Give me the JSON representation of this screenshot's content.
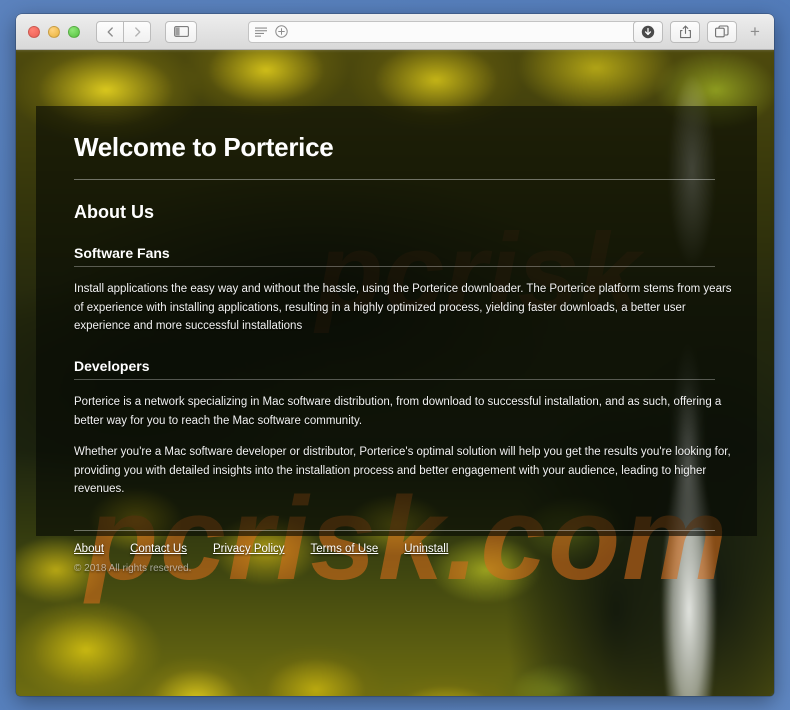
{
  "window": {
    "traffic_lights": [
      {
        "name": "close",
        "color": "#ec5f55"
      },
      {
        "name": "minimize",
        "color": "#e9b23c"
      },
      {
        "name": "zoom",
        "color": "#55c13f"
      }
    ]
  },
  "toolbar": {
    "back_icon": "chevron-left-icon",
    "forward_icon": "chevron-right-icon",
    "sidebar_icon": "sidebar-toggle-icon",
    "reader_icon": "reader-view-icon",
    "zoom_icon": "page-zoom-icon",
    "reload_icon": "reload-icon",
    "downloads_icon": "downloads-icon",
    "share_icon": "share-icon",
    "tabs_icon": "show-tabs-icon",
    "newtab_label": "+",
    "url_value": "",
    "url_placeholder": ""
  },
  "page": {
    "title": "Welcome to Porterice",
    "about_heading": "About Us",
    "sections": [
      {
        "heading": "Software Fans",
        "paragraphs": [
          "Install applications the easy way and without the hassle, using the Porterice downloader. The Porterice platform stems from years of experience with installing applications, resulting in a highly optimized process, yielding faster downloads, a better user experience and more successful installations"
        ]
      },
      {
        "heading": "Developers",
        "paragraphs": [
          "Porterice is a network specializing in Mac software distribution, from download to successful installation, and as such, offering a better way for you to reach the Mac software community.",
          "Whether you're a Mac software developer or distributor, Porterice's optimal solution will help you get the results you're looking for, providing you with detailed insights into the installation process and better engagement with your audience, leading to higher revenues."
        ]
      }
    ],
    "footer": {
      "links": [
        {
          "label": "About"
        },
        {
          "label": "Contact Us"
        },
        {
          "label": "Privacy Policy"
        },
        {
          "label": "Terms of Use"
        },
        {
          "label": "Uninstall"
        }
      ],
      "copyright": "© 2018 All rights reserved."
    },
    "watermark": "pcrisk.com",
    "watermark_top": "pcrisk"
  },
  "colors": {
    "desktop": "#5b82bd",
    "panel_overlay": "rgba(5,8,4,0.60)",
    "watermark": "#d66c1c",
    "text": "#ffffff"
  }
}
